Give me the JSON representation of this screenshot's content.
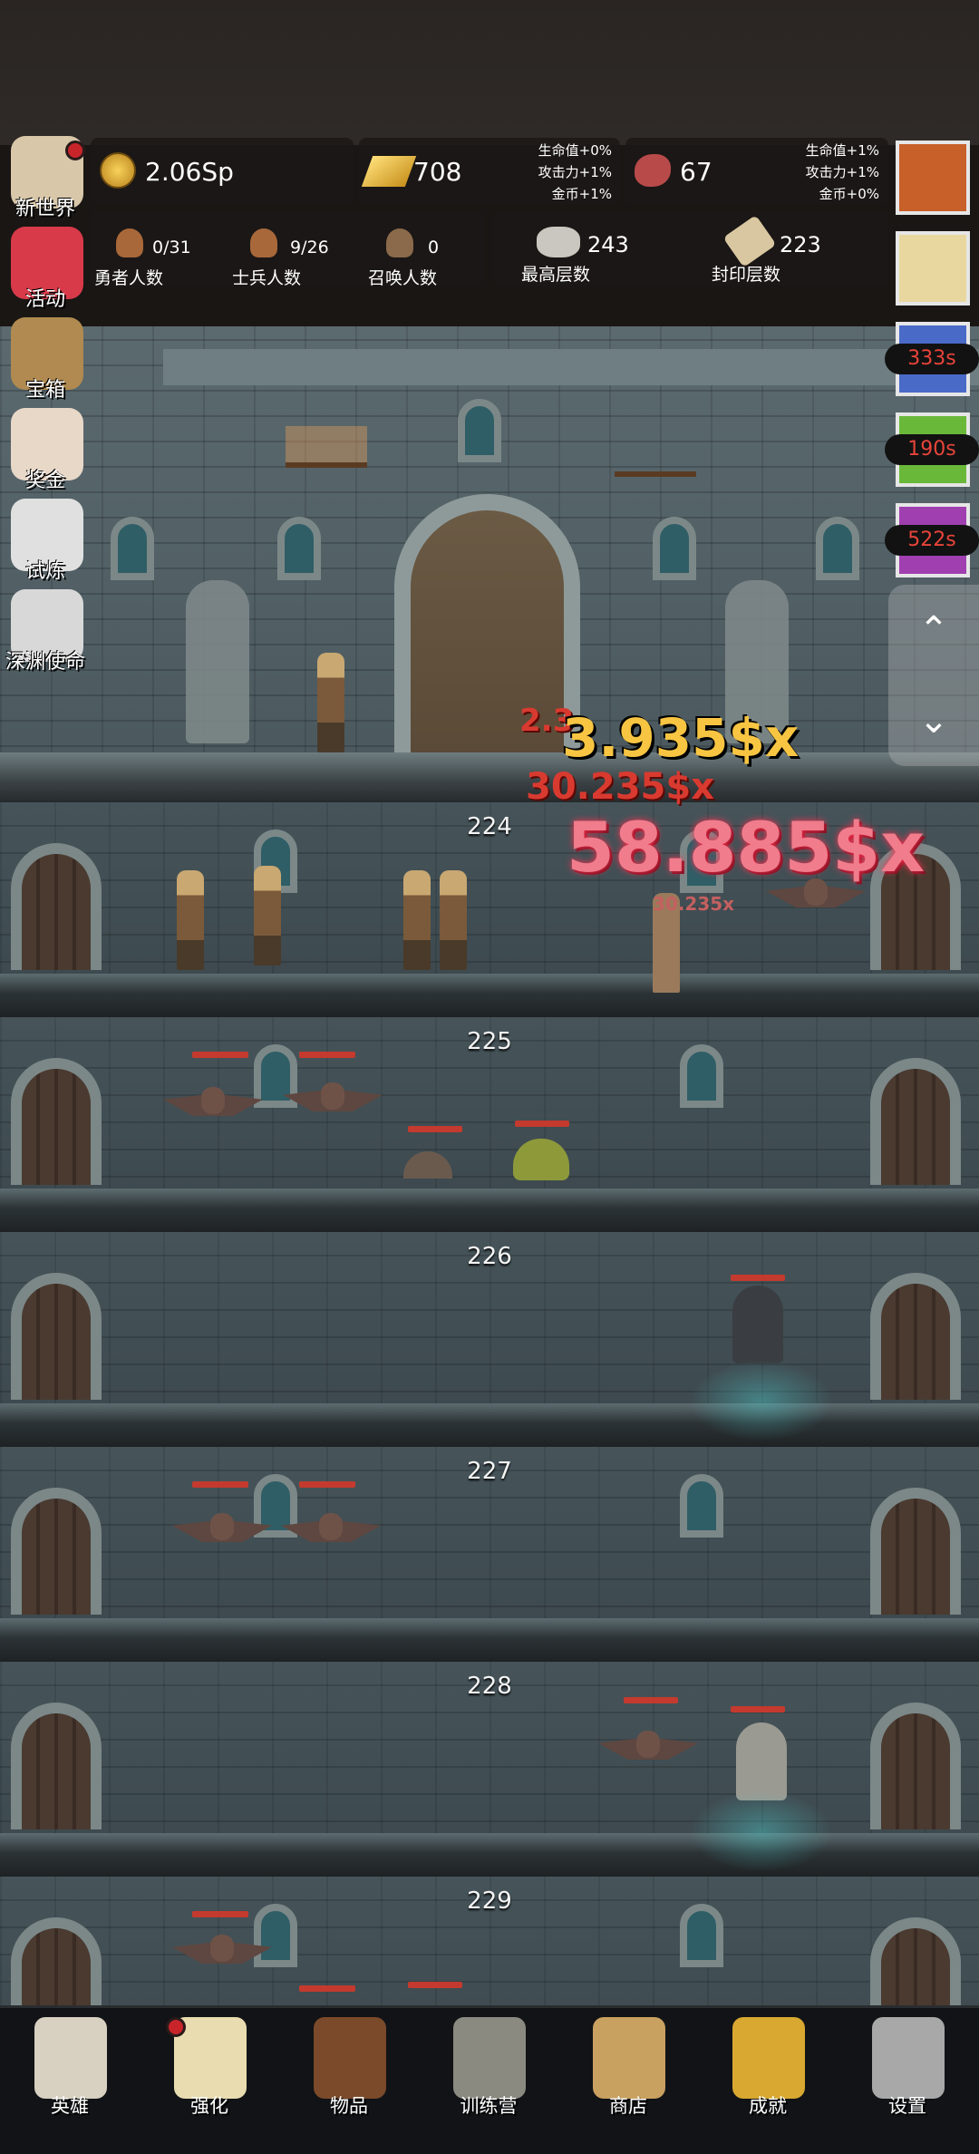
{
  "resources": {
    "gold": "2.06Sp",
    "gold_bar": "708",
    "gold_bar_bonus": [
      "生命值+0%",
      "攻击力+1%",
      "金币+1%"
    ],
    "meat": "67",
    "meat_bonus": [
      "生命值+1%",
      "攻击力+1%",
      "金币+0%"
    ]
  },
  "counts": {
    "brave": {
      "value": "0/31",
      "label": "勇者人数"
    },
    "soldier": {
      "value": "9/26",
      "label": "士兵人数"
    },
    "summon": {
      "value": "0",
      "label": "召唤人数"
    },
    "max_floor": {
      "value": "243",
      "label": "最高层数"
    },
    "sealed_floor": {
      "value": "223",
      "label": "封印层数"
    }
  },
  "left_menu": [
    {
      "label": "新世界",
      "icon": "map-icon",
      "color": "#d8c7a8"
    },
    {
      "label": "活动",
      "icon": "heart-icon",
      "color": "#d83a4a"
    },
    {
      "label": "宝箱",
      "icon": "treasure-chest-icon",
      "color": "#b08a50"
    },
    {
      "label": "奖金",
      "icon": "envelope-icon",
      "color": "#e8d8c8"
    },
    {
      "label": "试炼",
      "icon": "feather-icon",
      "color": "#e0e0e0"
    },
    {
      "label": "深渊使命",
      "icon": "pearl-icon",
      "color": "#d8d8d8"
    }
  ],
  "buffs": [
    {
      "icon": "pumpkin-icon",
      "color": "#c8602a",
      "timer": ""
    },
    {
      "icon": "candle-icon",
      "color": "#e8d8a0",
      "timer": ""
    },
    {
      "icon": "blue-potion-icon",
      "color": "#4a6ac8",
      "timer": "333s"
    },
    {
      "icon": "green-potion-icon",
      "color": "#6ab83a",
      "timer": "190s"
    },
    {
      "icon": "purple-potion-icon",
      "color": "#a040b0",
      "timer": "522s"
    }
  ],
  "floors": [
    "224",
    "225",
    "226",
    "227",
    "228",
    "229"
  ],
  "damage": {
    "gold": "3.935$x",
    "red1": "30.235$x",
    "red_small": "2.3",
    "pink": "58.885$x",
    "small": "30.235x"
  },
  "bottom_nav": [
    {
      "label": "英雄",
      "icon": "skull-icon",
      "color": "#d8d0c0"
    },
    {
      "label": "强化",
      "icon": "candle-icon",
      "color": "#e8dcb0"
    },
    {
      "label": "物品",
      "icon": "book-icon",
      "color": "#7a4a2a"
    },
    {
      "label": "训练营",
      "icon": "lantern-icon",
      "color": "#8a8a80"
    },
    {
      "label": "商店",
      "icon": "beer-mug-icon",
      "color": "#c8a060"
    },
    {
      "label": "成就",
      "icon": "key-icon",
      "color": "#d8a830"
    },
    {
      "label": "设置",
      "icon": "gear-icon",
      "color": "#a8a8a8"
    }
  ],
  "colors": {
    "hp_bar": "#c43a2e",
    "timer_text": "#e8443a",
    "damage_gold": "#f7c542",
    "damage_pink": "#f07c8c"
  }
}
